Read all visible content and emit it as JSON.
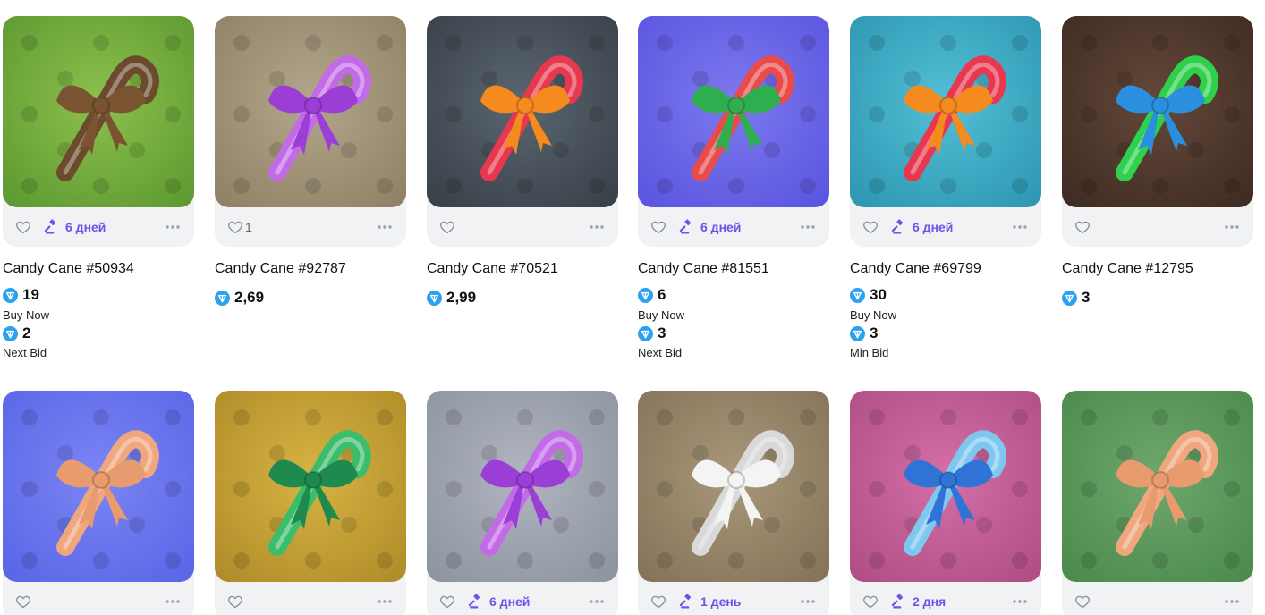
{
  "colors": {
    "accent": "#6b54e8",
    "ton": "#2aa2f0"
  },
  "row1": [
    {
      "title": "Candy Cane #50934",
      "likes": "",
      "auction": "6 дней",
      "price": "19",
      "price_label": "Buy Now",
      "bid": "2",
      "bid_label": "Next Bid",
      "bg": [
        "#8cc04c",
        "#5e9a32"
      ],
      "cane": "#6b4a2e",
      "bow": "#7a5330"
    },
    {
      "title": "Candy Cane #92787",
      "likes": "1",
      "auction": "",
      "price": "2,69",
      "price_label": "",
      "bid": "",
      "bid_label": "",
      "bg": [
        "#b3a68b",
        "#8f8267"
      ],
      "cane": "#c36be6",
      "bow": "#9b3ed6"
    },
    {
      "title": "Candy Cane #70521",
      "likes": "",
      "auction": "",
      "price": "2,99",
      "price_label": "",
      "bid": "",
      "bid_label": "",
      "bg": [
        "#5b6670",
        "#394149"
      ],
      "cane": "#e8384f",
      "bow": "#f58a1e"
    },
    {
      "title": "Candy Cane #81551",
      "likes": "",
      "auction": "6 дней",
      "price": "6",
      "price_label": "Buy Now",
      "bid": "3",
      "bid_label": "Next Bid",
      "bg": [
        "#7d78ee",
        "#5b56e0"
      ],
      "cane": "#e94a4a",
      "bow": "#2fae4f"
    },
    {
      "title": "Candy Cane #69799",
      "likes": "",
      "auction": "6 дней",
      "price": "30",
      "price_label": "Buy Now",
      "bid": "3",
      "bid_label": "Min Bid",
      "bg": [
        "#52c0d6",
        "#2f97b2"
      ],
      "cane": "#e8384f",
      "bow": "#f58a1e"
    },
    {
      "title": "Candy Cane #12795",
      "likes": "",
      "auction": "",
      "price": "3",
      "price_label": "",
      "bid": "",
      "bid_label": "",
      "bg": [
        "#64483a",
        "#3f2c22"
      ],
      "cane": "#2fd04c",
      "bow": "#2b8fe0"
    }
  ],
  "row2": [
    {
      "likes": "",
      "auction": "",
      "bg": [
        "#7b85f4",
        "#5a66e6"
      ],
      "cane": "#f0a77e",
      "bow": "#e89b6e"
    },
    {
      "likes": "",
      "auction": "",
      "bg": [
        "#d6b343",
        "#b18d2a"
      ],
      "cane": "#3bbd6d",
      "bow": "#1f8a4e"
    },
    {
      "likes": "",
      "auction": "6 дней",
      "bg": [
        "#b0b5c0",
        "#8e94a0"
      ],
      "cane": "#c36be6",
      "bow": "#9b3ed6"
    },
    {
      "likes": "",
      "auction": "1 день",
      "bg": [
        "#a8977a",
        "#857459"
      ],
      "cane": "#d9d9d9",
      "bow": "#f4f4f4"
    },
    {
      "likes": "",
      "auction": "2 дня",
      "bg": [
        "#d46fa7",
        "#b14e86"
      ],
      "cane": "#7ec8f0",
      "bow": "#2f73d6"
    },
    {
      "likes": "",
      "auction": "",
      "bg": [
        "#6ea76d",
        "#4c8a4d"
      ],
      "cane": "#f0a77e",
      "bow": "#e89b6e"
    }
  ],
  "icons": {
    "like": "heart-icon",
    "auction": "gavel-icon",
    "more": "more-dots-icon",
    "currency": "ton-icon"
  }
}
